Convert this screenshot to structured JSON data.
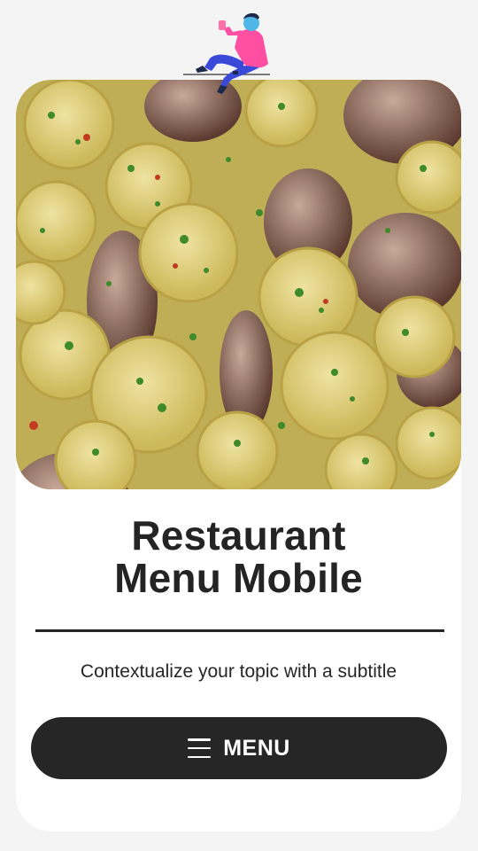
{
  "hero": {
    "illustration": "person-sitting-with-drink-illustration",
    "photo": "pasta-with-clams-photo"
  },
  "title": {
    "line1": "Restaurant",
    "line2": "Menu Mobile"
  },
  "subtitle": "Contextualize your topic with a subtitle",
  "menu_button": {
    "label": "MENU",
    "icon": "hamburger-icon"
  },
  "colors": {
    "background": "#f4f4f4",
    "card": "#ffffff",
    "text": "#242424",
    "button": "#262626",
    "button_text": "#ffffff"
  }
}
